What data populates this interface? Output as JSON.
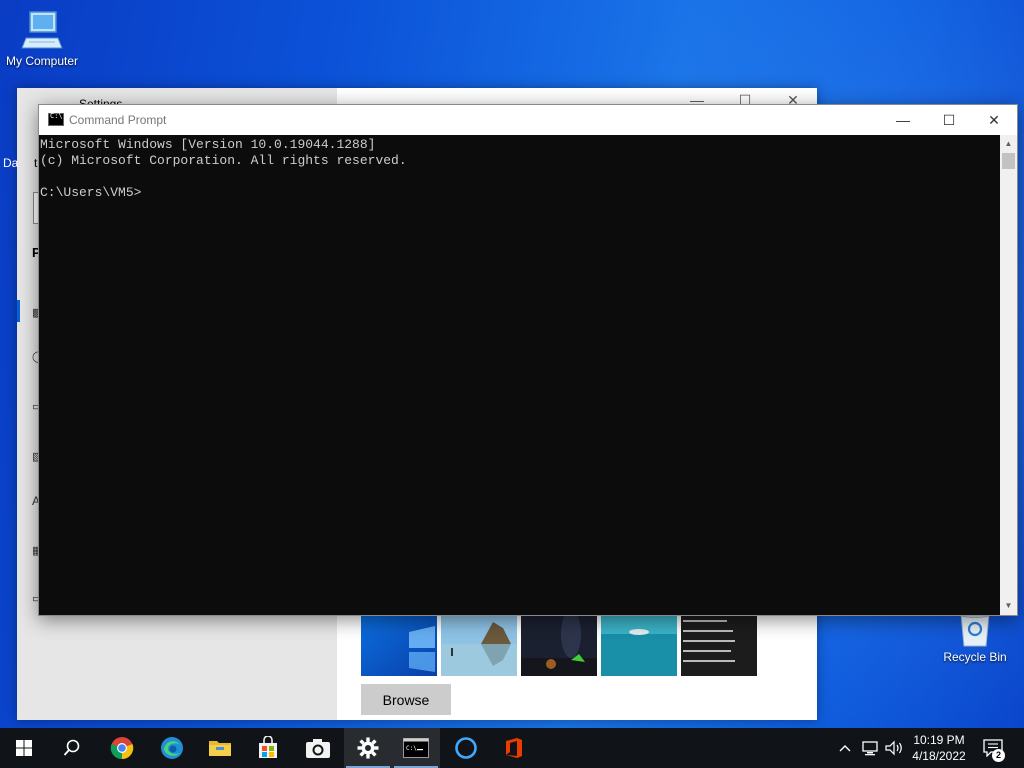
{
  "desktop": {
    "icons": [
      {
        "label": "My Computer",
        "icon": "computer-icon"
      },
      {
        "label": "Recycle Bin",
        "icon": "recycle-bin-icon"
      }
    ]
  },
  "settings_window": {
    "title": "Settings",
    "back_icon": "back-arrow-icon",
    "browse_label": "Browse",
    "partial_labels": [
      "Da",
      "t",
      "P",
      "A"
    ]
  },
  "cmd_window": {
    "title": "Command Prompt",
    "lines": [
      "Microsoft Windows [Version 10.0.19044.1288]",
      "(c) Microsoft Corporation. All rights reserved.",
      "",
      "C:\\Users\\VM5>"
    ],
    "buttons": {
      "minimize": "—",
      "maximize": "☐",
      "close": "✕"
    },
    "colors": {
      "background": "#0c0c0c",
      "text": "#cccccc"
    }
  },
  "taskbar": {
    "apps": [
      {
        "name": "start",
        "icon": "windows-logo-icon"
      },
      {
        "name": "search",
        "icon": "search-icon"
      },
      {
        "name": "chrome",
        "icon": "chrome-icon"
      },
      {
        "name": "edge",
        "icon": "edge-icon"
      },
      {
        "name": "file-explorer",
        "icon": "folder-icon"
      },
      {
        "name": "store",
        "icon": "store-icon"
      },
      {
        "name": "camera",
        "icon": "camera-icon"
      },
      {
        "name": "settings",
        "icon": "gear-icon",
        "active": true
      },
      {
        "name": "command-prompt",
        "icon": "terminal-icon",
        "active": true
      },
      {
        "name": "cortana",
        "icon": "cortana-icon"
      },
      {
        "name": "office",
        "icon": "office-icon"
      }
    ],
    "time": "10:19 PM",
    "date": "4/18/2022",
    "notification_count": "2"
  }
}
